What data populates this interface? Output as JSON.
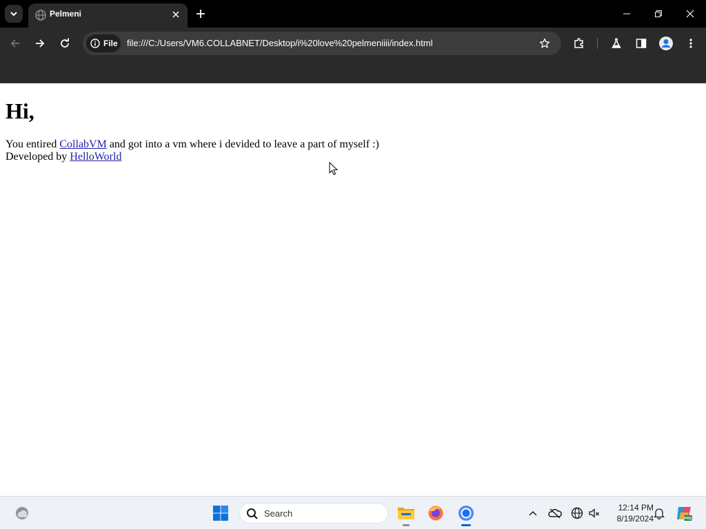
{
  "browser": {
    "tab": {
      "title": "Pelmeni"
    },
    "address_bar": {
      "chip_label": "File",
      "url": "file:///C:/Users/VM6.COLLABNET/Desktop/i%20love%20pelmeniiii/index.html"
    }
  },
  "page": {
    "heading": "Hi,",
    "line1": {
      "prefix": "You entired ",
      "link": "CollabVM",
      "suffix": " and got into a vm where i devided to leave a part of myself :)"
    },
    "line2": {
      "prefix": "Developed by ",
      "link": "HelloWorld"
    }
  },
  "taskbar": {
    "search_placeholder": "Search",
    "clock_time": "12:14 PM",
    "clock_date": "8/19/2024"
  },
  "colors": {
    "titlebar": "#000000",
    "toolbar": "#2a2a2a",
    "omnibox": "#3c3c3c",
    "link": "#1f1fa8",
    "taskbar": "#eef1f6",
    "accent": "#0067c0"
  },
  "icons": [
    "tab-search-icon",
    "globe-favicon-icon",
    "close-icon",
    "plus-icon",
    "minimize-icon",
    "restore-icon",
    "window-close-icon",
    "back-arrow-icon",
    "forward-arrow-icon",
    "reload-icon",
    "info-icon",
    "star-icon",
    "extensions-icon",
    "labs-flask-icon",
    "side-panel-icon",
    "profile-icon",
    "more-vert-icon",
    "weather-icon",
    "windows-start-icon",
    "search-icon",
    "file-explorer-icon",
    "firefox-icon",
    "chrome-icon",
    "chevron-up-icon",
    "onedrive-offline-icon",
    "network-globe-icon",
    "volume-icon",
    "bell-icon",
    "copilot-icon",
    "mouse-cursor-icon"
  ]
}
